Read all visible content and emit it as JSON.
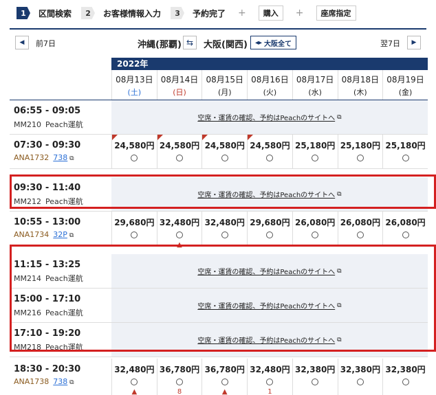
{
  "steps": [
    {
      "num": "1",
      "label": "区間検索",
      "active": true
    },
    {
      "num": "2",
      "label": "お客様情報入力",
      "active": false
    },
    {
      "num": "3",
      "label": "予約完了",
      "active": false
    }
  ],
  "options": [
    "購入",
    "座席指定"
  ],
  "plus": "+",
  "route": {
    "prev_label": "前7日",
    "next_label": "翌7日",
    "origin": "沖縄(那覇)",
    "destination": "大阪(関西)",
    "all_osaka": "大阪全て",
    "swap_icon": "⇆",
    "prev_icon": "◀",
    "next_icon": "▶"
  },
  "year": "2022年",
  "dates": [
    {
      "date": "08月13日",
      "weekday": "(土)",
      "type": "sat"
    },
    {
      "date": "08月14日",
      "weekday": "(日)",
      "type": "sun"
    },
    {
      "date": "08月15日",
      "weekday": "(月)",
      "type": ""
    },
    {
      "date": "08月16日",
      "weekday": "(火)",
      "type": ""
    },
    {
      "date": "08月17日",
      "weekday": "(水)",
      "type": ""
    },
    {
      "date": "08月18日",
      "weekday": "(木)",
      "type": ""
    },
    {
      "date": "08月19日",
      "weekday": "(金)",
      "type": ""
    }
  ],
  "peach_text": "空席・運賃の確認、予約はPeachのサイトへ",
  "flights": [
    {
      "time": "06:55 - 09:05",
      "code": "MM210",
      "op": "Peach運航",
      "peach": true
    },
    {
      "time": "07:30 - 09:30",
      "code": "ANA1732",
      "op": "738",
      "peach": false,
      "fares": [
        {
          "price": "24,580円",
          "mark": "",
          "corner": true
        },
        {
          "price": "24,580円",
          "mark": "",
          "corner": true
        },
        {
          "price": "24,580円",
          "mark": "",
          "corner": true
        },
        {
          "price": "24,580円",
          "mark": "",
          "corner": true
        },
        {
          "price": "25,180円",
          "mark": "",
          "corner": false
        },
        {
          "price": "25,180円",
          "mark": "",
          "corner": false
        },
        {
          "price": "25,180円",
          "mark": "",
          "corner": false
        }
      ]
    },
    {
      "time": "09:30 - 11:40",
      "code": "MM212",
      "op": "Peach運航",
      "peach": true
    },
    {
      "time": "10:55 - 13:00",
      "code": "ANA1734",
      "op": "32P",
      "peach": false,
      "fares": [
        {
          "price": "29,680円",
          "mark": "",
          "corner": false
        },
        {
          "price": "32,480円",
          "mark": "▲",
          "corner": false
        },
        {
          "price": "32,480円",
          "mark": "",
          "corner": false
        },
        {
          "price": "29,680円",
          "mark": "",
          "corner": false
        },
        {
          "price": "26,080円",
          "mark": "",
          "corner": false
        },
        {
          "price": "26,080円",
          "mark": "",
          "corner": false
        },
        {
          "price": "26,080円",
          "mark": "",
          "corner": false
        }
      ]
    },
    {
      "time": "11:15 - 13:25",
      "code": "MM214",
      "op": "Peach運航",
      "peach": true
    },
    {
      "time": "15:00 - 17:10",
      "code": "MM216",
      "op": "Peach運航",
      "peach": true
    },
    {
      "time": "17:10 - 19:20",
      "code": "MM218",
      "op": "Peach運航",
      "peach": true
    },
    {
      "time": "18:30 - 20:30",
      "code": "ANA1738",
      "op": "738",
      "peach": false,
      "fares": [
        {
          "price": "32,480円",
          "mark": "▲",
          "corner": false
        },
        {
          "price": "36,780円",
          "mark": "8",
          "corner": false
        },
        {
          "price": "36,780円",
          "mark": "▲",
          "corner": false
        },
        {
          "price": "32,480円",
          "mark": "1",
          "corner": false
        },
        {
          "price": "32,380円",
          "mark": "",
          "corner": false
        },
        {
          "price": "32,380円",
          "mark": "",
          "corner": false
        },
        {
          "price": "32,380円",
          "mark": "",
          "corner": false
        }
      ]
    }
  ],
  "colors": {
    "navy": "#1a3a6e",
    "highlight": "#d42020",
    "peach_bg": "#eef1f6"
  }
}
